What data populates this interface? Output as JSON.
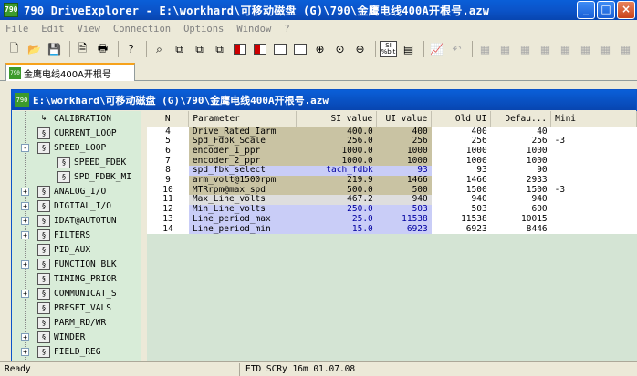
{
  "window": {
    "title": "790 DriveExplorer - E:\\workhard\\可移动磁盘 (G)\\790\\金鹰电线400A开根号.azw",
    "app_icon_text": "790"
  },
  "menu": [
    "File",
    "Edit",
    "View",
    "Connection",
    "Options",
    "Window",
    "?"
  ],
  "tab": {
    "label": "金鹰电线400A开根号"
  },
  "child_window": {
    "title": "E:\\workhard\\可移动磁盘 (G)\\790\\金鹰电线400A开根号.azw"
  },
  "toolbar": {
    "si_label": "SI\n%bit"
  },
  "tree": [
    {
      "label": "CALIBRATION",
      "level": 1,
      "expander": ""
    },
    {
      "label": "CURRENT_LOOP",
      "level": 1,
      "expander": ""
    },
    {
      "label": "SPEED_LOOP",
      "level": 1,
      "expander": "-"
    },
    {
      "label": "SPEED_FDBK",
      "level": 2,
      "expander": ""
    },
    {
      "label": "SPD_FDBK_MI",
      "level": 2,
      "expander": ""
    },
    {
      "label": "ANALOG_I/O",
      "level": 1,
      "expander": "+"
    },
    {
      "label": "DIGITAL_I/O",
      "level": 1,
      "expander": "+"
    },
    {
      "label": "IDAT@AUTOTUN",
      "level": 1,
      "expander": "+"
    },
    {
      "label": "FILTERS",
      "level": 1,
      "expander": "+"
    },
    {
      "label": "PID_AUX",
      "level": 1,
      "expander": ""
    },
    {
      "label": "FUNCTION_BLK",
      "level": 1,
      "expander": "+"
    },
    {
      "label": "TIMING_PRIOR",
      "level": 1,
      "expander": ""
    },
    {
      "label": "COMMUNICAT_S",
      "level": 1,
      "expander": "+"
    },
    {
      "label": "PRESET_VALS",
      "level": 1,
      "expander": ""
    },
    {
      "label": "PARM_RD/WR",
      "level": 1,
      "expander": ""
    },
    {
      "label": "WINDER",
      "level": 1,
      "expander": "+"
    },
    {
      "label": "FIELD_REG",
      "level": 1,
      "expander": "+"
    }
  ],
  "table": {
    "columns": [
      "N",
      "Parameter",
      "SI value",
      "UI value",
      "Old UI",
      "Defau...",
      "Mini"
    ],
    "rows": [
      {
        "n": "4",
        "param": "Drive_Rated_Iarm",
        "si": "400.0",
        "ui": "400",
        "old": "400",
        "def": "40",
        "min": "",
        "style": "kh"
      },
      {
        "n": "5",
        "param": "Spd_Fdbk_Scale",
        "si": "256.0",
        "ui": "256",
        "old": "256",
        "def": "256",
        "min": "-3",
        "style": "kh"
      },
      {
        "n": "6",
        "param": "encoder_1_ppr",
        "si": "1000.0",
        "ui": "1000",
        "old": "1000",
        "def": "1000",
        "min": "",
        "style": "kh"
      },
      {
        "n": "7",
        "param": "encoder_2_ppr",
        "si": "1000.0",
        "ui": "1000",
        "old": "1000",
        "def": "1000",
        "min": "",
        "style": "kh"
      },
      {
        "n": "8",
        "param": "spd_fbk_select",
        "si": "tach_fdbk",
        "ui": "93",
        "old": "93",
        "def": "90",
        "min": "",
        "style": "sel"
      },
      {
        "n": "9",
        "param": "arm_volt@1500rpm",
        "si": "219.9",
        "ui": "1466",
        "old": "1466",
        "def": "2933",
        "min": "",
        "style": "kh"
      },
      {
        "n": "10",
        "param": "MTRrpm@max_spd",
        "si": "500.0",
        "ui": "500",
        "old": "1500",
        "def": "1500",
        "min": "-3",
        "style": "kh"
      },
      {
        "n": "11",
        "param": "Max_Line_volts",
        "si": "467.2",
        "ui": "940",
        "old": "940",
        "def": "940",
        "min": "",
        "style": "gr"
      },
      {
        "n": "12",
        "param": "Min_Line_volts",
        "si": "250.0",
        "ui": "503",
        "old": "503",
        "def": "600",
        "min": "",
        "style": "sel"
      },
      {
        "n": "13",
        "param": "Line_period_max",
        "si": "25.0",
        "ui": "11538",
        "old": "11538",
        "def": "10015",
        "min": "",
        "style": "sel"
      },
      {
        "n": "14",
        "param": "Line_period_min",
        "si": "15.0",
        "ui": "6923",
        "old": "6923",
        "def": "8446",
        "min": "",
        "style": "sel"
      }
    ]
  },
  "status": {
    "left": "Ready",
    "right": "ETD SCRy 16m 01.07.08"
  }
}
